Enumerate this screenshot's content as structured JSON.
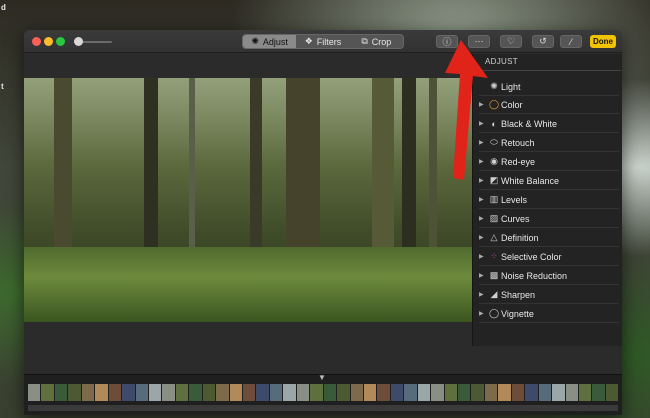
{
  "desktop": {
    "corner_texts": [
      "d",
      "t"
    ]
  },
  "window": {
    "toolbar": {
      "tabs": [
        {
          "label": "Adjust",
          "icon": "adjust-icon",
          "active": true
        },
        {
          "label": "Filters",
          "icon": "filters-icon",
          "active": false
        },
        {
          "label": "Crop",
          "icon": "crop-icon",
          "active": false
        }
      ],
      "buttons": [
        "info-icon",
        "more-icon",
        "heart-icon",
        "rotate-icon",
        "magic-wand-icon"
      ],
      "done_label": "Done"
    },
    "sidebar": {
      "title": "ADJUST",
      "items": [
        {
          "label": "Light",
          "icon": "sun-icon"
        },
        {
          "label": "Color",
          "icon": "circle-icon"
        },
        {
          "label": "Black & White",
          "icon": "half-circle-icon"
        },
        {
          "label": "Retouch",
          "icon": "bandage-icon"
        },
        {
          "label": "Red-eye",
          "icon": "eye-icon"
        },
        {
          "label": "White Balance",
          "icon": "white-balance-icon"
        },
        {
          "label": "Levels",
          "icon": "levels-icon"
        },
        {
          "label": "Curves",
          "icon": "curves-icon"
        },
        {
          "label": "Definition",
          "icon": "triangle-icon"
        },
        {
          "label": "Selective Color",
          "icon": "color-dots-icon"
        },
        {
          "label": "Noise Reduction",
          "icon": "noise-icon"
        },
        {
          "label": "Sharpen",
          "icon": "sharpen-icon"
        },
        {
          "label": "Vignette",
          "icon": "vignette-icon"
        }
      ]
    }
  },
  "colors": {
    "done": "#f2c400",
    "annotation": "#e02419"
  }
}
